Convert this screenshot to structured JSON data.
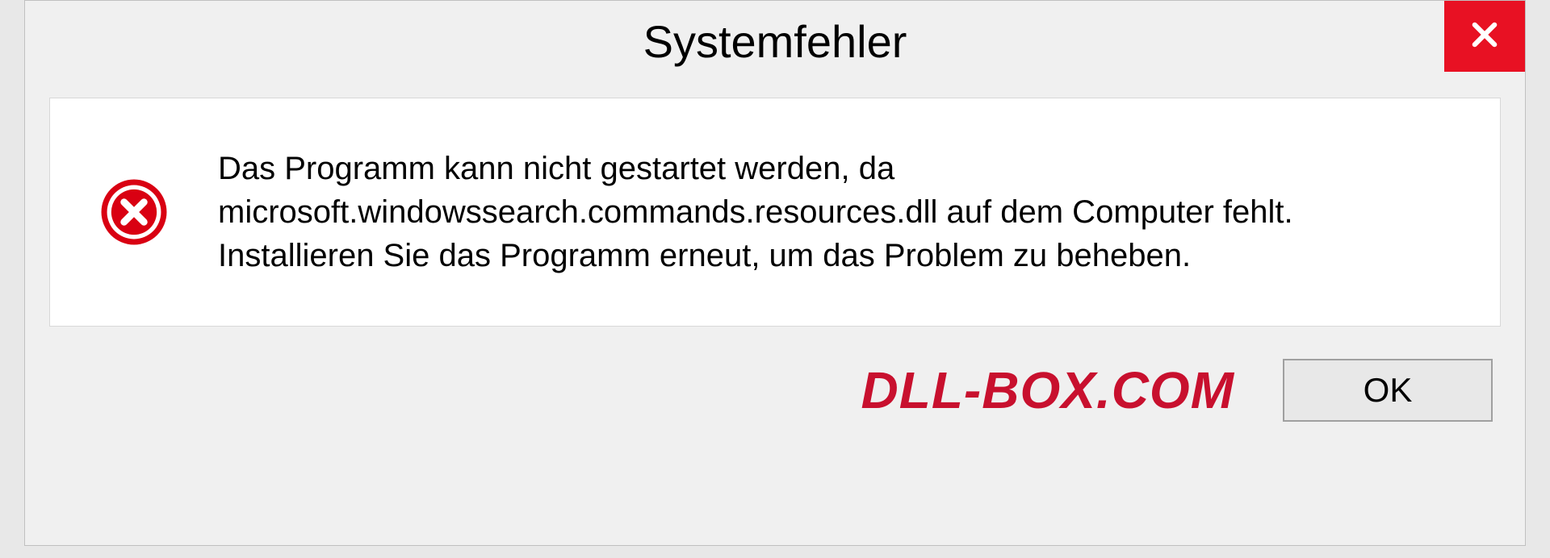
{
  "dialog": {
    "title": "Systemfehler",
    "message": "Das Programm kann nicht gestartet werden, da microsoft.windowssearch.commands.resources.dll auf dem Computer fehlt. Installieren Sie das Programm erneut, um das Problem zu beheben.",
    "ok_label": "OK"
  },
  "watermark": "DLL-BOX.COM",
  "colors": {
    "close_button": "#e81123",
    "error_icon": "#d90012",
    "watermark": "#c8102e"
  }
}
